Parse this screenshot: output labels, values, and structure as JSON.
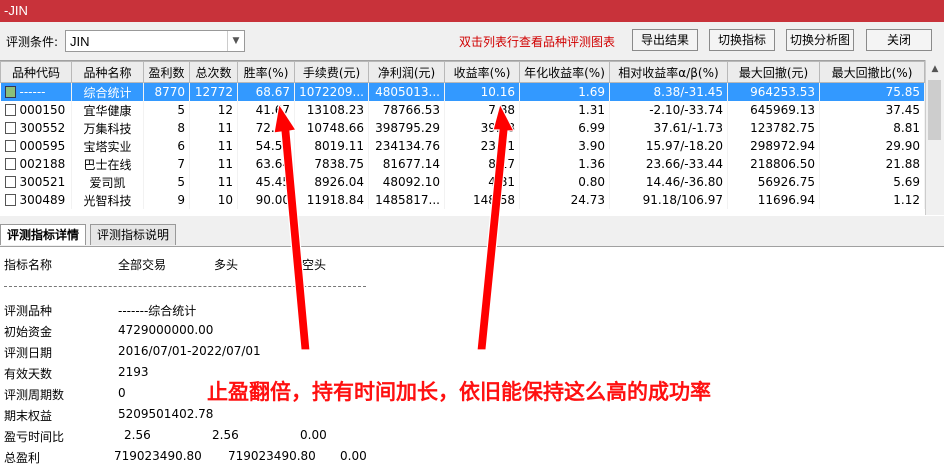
{
  "window": {
    "title": "-JIN"
  },
  "toolbar": {
    "condition_label": "评测条件:",
    "condition_value": "JIN",
    "hint": "双击列表行查看品种评测图表",
    "buttons": [
      "导出结果",
      "切换指标",
      "切换分析图",
      "关闭"
    ]
  },
  "table": {
    "columns": [
      "品种代码",
      "品种名称",
      "盈利数",
      "总次数",
      "胜率(%)",
      "手续费(元)",
      "净利润(元)",
      "收益率(%)",
      "年化收益率(%)",
      "相对收益率α/β(%)",
      "最大回撤(元)",
      "最大回撤比(%)"
    ],
    "rows": [
      [
        "------",
        "综合统计",
        "8770",
        "12772",
        "68.67",
        "1072209...",
        "4805013...",
        "10.16",
        "1.69",
        "8.38/-31.45",
        "964253.53",
        "75.85"
      ],
      [
        "000150",
        "宜华健康",
        "5",
        "12",
        "41.67",
        "13108.23",
        "78766.53",
        "7.88",
        "1.31",
        "-2.10/-33.74",
        "645969.13",
        "37.45"
      ],
      [
        "300552",
        "万集科技",
        "8",
        "11",
        "72.73",
        "10748.66",
        "398795.29",
        "39.88",
        "6.99",
        "37.61/-1.73",
        "123782.75",
        "8.81"
      ],
      [
        "000595",
        "宝塔实业",
        "6",
        "11",
        "54.55",
        "8019.11",
        "234134.76",
        "23.41",
        "3.90",
        "15.97/-18.20",
        "298972.94",
        "29.90"
      ],
      [
        "002188",
        "巴士在线",
        "7",
        "11",
        "63.64",
        "7838.75",
        "81677.14",
        "8.17",
        "1.36",
        "23.66/-33.44",
        "218806.50",
        "21.88"
      ],
      [
        "300521",
        "爱司凯",
        "5",
        "11",
        "45.45",
        "8926.04",
        "48092.10",
        "4.81",
        "0.80",
        "14.46/-36.80",
        "56926.75",
        "5.69"
      ],
      [
        "300489",
        "光智科技",
        "9",
        "10",
        "90.00",
        "11918.84",
        "1485817...",
        "148.58",
        "24.73",
        "91.18/106.97",
        "11696.94",
        "1.12"
      ]
    ]
  },
  "tabs": [
    "评测指标详情",
    "评测指标说明"
  ],
  "detail": {
    "headers": [
      "指标名称",
      "全部交易",
      "多头",
      "空头"
    ],
    "rows": [
      {
        "name": "评测品种",
        "all": "-------综合统计",
        "long": "",
        "short": ""
      },
      {
        "name": "初始资金",
        "all": "4729000000.00",
        "long": "",
        "short": ""
      },
      {
        "name": "评测日期",
        "all": "2016/07/01-2022/07/01",
        "long": "",
        "short": ""
      },
      {
        "name": "有效天数",
        "all": "2193",
        "long": "",
        "short": ""
      },
      {
        "name": "评测周期数",
        "all": "0",
        "long": "",
        "short": ""
      },
      {
        "name": "期末权益",
        "all": "5209501402.78",
        "long": "",
        "short": ""
      },
      {
        "name": "盈亏时间比",
        "all": "2.56",
        "long": "2.56",
        "short": "0.00"
      },
      {
        "name": "总盈利",
        "all": "719023490.80",
        "long": "719023490.80",
        "short": "0.00"
      }
    ]
  },
  "annotation": {
    "text": "止盈翻倍，持有时间加长，依旧能保持这么高的成功率",
    "color": "#ff1010"
  }
}
